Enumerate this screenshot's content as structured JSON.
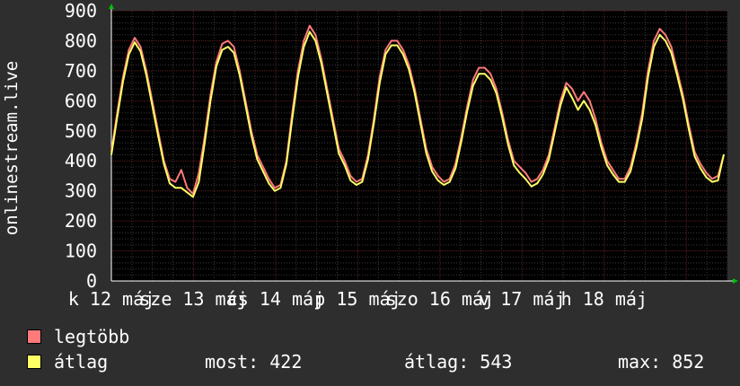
{
  "chart_data": {
    "type": "line",
    "ylabel": "onlinestream.live",
    "ylim": [
      0,
      900
    ],
    "y_ticks": [
      "0",
      "100",
      "200",
      "300",
      "400",
      "500",
      "600",
      "700",
      "800",
      "900"
    ],
    "x_tick_labels": [
      "k 12 máj",
      "sze 13 máj",
      "cs 14 máj",
      "p 15 máj",
      "szo 16 máj",
      "v 17 máj",
      "h 18 máj"
    ],
    "grid": true,
    "legend": "bottom-left",
    "colors": {
      "background": "#2e2e2e",
      "plot_bg": "#000000",
      "grid_minor": "#3a3a3a",
      "grid_major": "#5a2020",
      "max_series": "#ff7a7a",
      "avg_series": "#ffff66"
    },
    "series": [
      {
        "name": "legtöbb",
        "color": "#ff7a7a",
        "values": [
          430,
          560,
          680,
          770,
          810,
          780,
          700,
          600,
          500,
          400,
          340,
          330,
          370,
          310,
          290,
          360,
          480,
          620,
          730,
          790,
          800,
          780,
          700,
          600,
          500,
          420,
          380,
          340,
          310,
          320,
          400,
          560,
          700,
          800,
          850,
          820,
          740,
          640,
          540,
          440,
          400,
          350,
          330,
          340,
          420,
          540,
          680,
          770,
          800,
          800,
          770,
          720,
          640,
          540,
          440,
          380,
          350,
          330,
          340,
          390,
          480,
          580,
          670,
          710,
          710,
          690,
          640,
          560,
          470,
          400,
          380,
          360,
          330,
          340,
          370,
          420,
          510,
          600,
          660,
          640,
          600,
          630,
          600,
          540,
          460,
          400,
          370,
          340,
          340,
          380,
          460,
          560,
          700,
          800,
          840,
          820,
          780,
          700,
          620,
          520,
          430,
          390,
          360,
          340,
          350,
          420
        ]
      },
      {
        "name": "átlag",
        "color": "#ffff66",
        "values": [
          420,
          545,
          665,
          755,
          795,
          765,
          685,
          585,
          485,
          390,
          325,
          310,
          310,
          295,
          280,
          330,
          460,
          600,
          715,
          770,
          780,
          760,
          685,
          585,
          485,
          405,
          365,
          325,
          300,
          310,
          390,
          540,
          680,
          780,
          830,
          800,
          725,
          625,
          525,
          425,
          385,
          335,
          320,
          330,
          405,
          525,
          660,
          755,
          785,
          785,
          755,
          705,
          625,
          525,
          425,
          365,
          335,
          320,
          330,
          375,
          465,
          565,
          650,
          690,
          690,
          670,
          625,
          545,
          455,
          385,
          360,
          340,
          315,
          325,
          355,
          405,
          495,
          585,
          645,
          610,
          570,
          600,
          570,
          520,
          445,
          385,
          355,
          330,
          330,
          365,
          445,
          540,
          680,
          780,
          820,
          800,
          760,
          685,
          605,
          505,
          415,
          375,
          345,
          330,
          335,
          422
        ]
      }
    ],
    "stats": {
      "now_label": "most:",
      "now_value": "422",
      "avg_label": "átlag:",
      "avg_value": "543",
      "max_label": "max:",
      "max_value": "852"
    }
  }
}
